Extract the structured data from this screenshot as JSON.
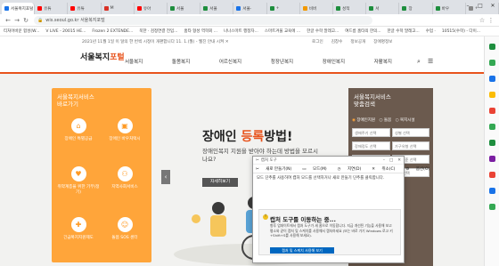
{
  "browser": {
    "tabs": [
      {
        "label": "서울복지포털",
        "color": "#1a73e8"
      },
      {
        "label": "유튜",
        "color": "#ff0000"
      },
      {
        "label": "유튜",
        "color": "#ff0000"
      },
      {
        "label": "M",
        "color": "#d93025"
      },
      {
        "label": "유아",
        "color": "#ff0000"
      },
      {
        "label": "서울",
        "color": "#1e8e3e"
      },
      {
        "label": "서울",
        "color": "#1e8e3e"
      },
      {
        "label": "서울·",
        "color": "#1a73e8"
      },
      {
        "label": "+",
        "color": "#1e8e3e"
      },
      {
        "label": "비버",
        "color": "#f29900"
      },
      {
        "label": "성적",
        "color": "#1e8e3e"
      },
      {
        "label": "서",
        "color": "#1e8e3e"
      },
      {
        "label": "장",
        "color": "#1e8e3e"
      },
      {
        "label": "바우",
        "color": "#1e8e3e"
      },
      {
        "label": "+",
        "color": "#888888"
      }
    ],
    "url": "wis.seoul.go.kr   서울복지포털",
    "bookmarks": [
      "티처어바운 합성(W...",
      "V LIVE - 20015 HE...",
      "Frozen 2 EXTENDE...",
      "북한 · 검정연결 전입...",
      "홈타 형성 역학회 ...",
      "나나스마트 행정자...",
      "스마트겨울 교육에 ...",
      "한글 수학 말레고...",
      "여드름 홈타의 한의...",
      "한글 수학 말레고...",
      "수업 ·",
      "10515(수학) - 다이..."
    ]
  },
  "site": {
    "util_left": "2021년 11월 1일 이 달의 한 번씩 시정이 개편합니다  11. 1.(월) - 웹진 안내 시켜 ✕",
    "util_right": [
      "로그인",
      "김창수",
      "정보공개",
      "장애명정보"
    ],
    "logo_prefix": "서울복지",
    "logo_main": "포털",
    "nav": [
      "서울복지",
      "돌봄복지",
      "어르신복지",
      "청장년복지",
      "장애인복지",
      "자활복지"
    ],
    "left_title_1": "서울복지서비스",
    "left_title_2": "바로가기",
    "services": [
      {
        "icon": "장애인 특별공급",
        "label": "장애인 특별공급"
      },
      {
        "icon": "장애인 바우처택시",
        "label": "장애인 바우처택시"
      },
      {
        "icon": "취약계층을 위한 기부(정기)",
        "label": "취약계층을 위한 기부(정기)"
      },
      {
        "icon": "지역사회서비스",
        "label": "지역사회서비스"
      },
      {
        "icon": "긴급복지지원제도",
        "label": "긴급복지지원제도"
      },
      {
        "icon": "돌봄 SOS 센터",
        "label": "돌봄 SOS 센터"
      }
    ],
    "banner_title_1": "장애인 ",
    "banner_title_hl": "등록",
    "banner_title_2": "방법!",
    "banner_sub": "장애인복지 지원을 받아야 하는데 방법을 모르시나요?",
    "more_label": "자세히보기",
    "right_title_1": "서울복지서비스",
    "right_title_2": "맞춤검색",
    "radios": [
      "장애인지원",
      "돌봄",
      "복지시설"
    ],
    "selects": [
      "생애주기 선택",
      "성별 선택",
      "장애정도 선택",
      "가구유형 선택",
      "소득기준 선택",
      "가구기준 선택",
      "사업수혜자 선택",
      "지역 선택"
    ]
  },
  "snip": {
    "title": "캡처 도구",
    "tools": [
      "새로 만들기(N)",
      "모드(M)",
      "지연(D)",
      "취소(C)",
      "옵션(O)"
    ],
    "msg": "모드 단추를 사용하여 캡처 모드를 선택하거나 새로 만들기 단추를 클릭합니다.",
    "notice_title": "캡처 도구를 이동하는 중...",
    "notice_body": "향후 업데이트에서 캡처 도구가 새 홈으로 이동합니다. 지금 개선된 기능을 사용해 보고 평소와 같이 캡처 및 스케치를 사용해서 캡처하세요 (또는 바로 가기 Windows 로고 키+Shift+S를 사용해 보세요).",
    "notice_button": "캡처 및 스케치 사용해 보기"
  }
}
